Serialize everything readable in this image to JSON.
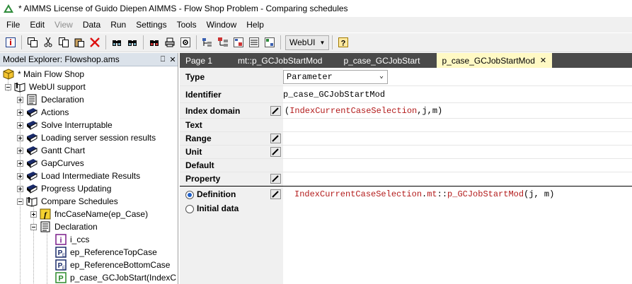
{
  "window": {
    "title": "* AIMMS License of Guido Diepen AIMMS - Flow Shop Problem - Comparing schedules"
  },
  "menu": {
    "items": [
      {
        "label": "File",
        "enabled": true
      },
      {
        "label": "Edit",
        "enabled": true
      },
      {
        "label": "View",
        "enabled": false
      },
      {
        "label": "Data",
        "enabled": true
      },
      {
        "label": "Run",
        "enabled": true
      },
      {
        "label": "Settings",
        "enabled": true
      },
      {
        "label": "Tools",
        "enabled": true
      },
      {
        "label": "Window",
        "enabled": true
      },
      {
        "label": "Help",
        "enabled": true
      }
    ]
  },
  "toolbar": {
    "webui_label": "WebUI"
  },
  "explorer": {
    "title": "Model Explorer: Flowshop.ams",
    "pin_glyph": "⎕",
    "close_glyph": "✕",
    "tree": [
      {
        "label": "* Main Flow Shop"
      },
      {
        "label": "WebUI support"
      },
      {
        "label": "Declaration"
      },
      {
        "label": "Actions"
      },
      {
        "label": "Solve Interruptable"
      },
      {
        "label": "Loading server session results"
      },
      {
        "label": "Gantt Chart"
      },
      {
        "label": "GapCurves"
      },
      {
        "label": "Load Intermediate Results"
      },
      {
        "label": "Progress Updating"
      },
      {
        "label": "Compare Schedules"
      },
      {
        "label": "fncCaseName(ep_Case)"
      },
      {
        "label": "Declaration"
      },
      {
        "label": "i_ccs"
      },
      {
        "label": "ep_ReferenceTopCase"
      },
      {
        "label": "ep_ReferenceBottomCase"
      },
      {
        "label": "p_case_GCJobStart(IndexC"
      }
    ]
  },
  "tabs": [
    {
      "label": "Page 1"
    },
    {
      "label": "mt::p_GCJobStartMod"
    },
    {
      "label": "p_case_GCJobStart"
    },
    {
      "label": "p_case_GCJobStartMod",
      "close": "✕"
    }
  ],
  "attributes": {
    "type": {
      "label": "Type",
      "value": "Parameter"
    },
    "identifier": {
      "label": "Identifier",
      "value": "p_case_GCJobStartMod"
    },
    "index_domain": {
      "label": "Index domain",
      "value_open": "(",
      "value_idx": "IndexCurrentCaseSelection",
      "value_rest": ",j,m)"
    },
    "text": {
      "label": "Text"
    },
    "range": {
      "label": "Range"
    },
    "unit": {
      "label": "Unit"
    },
    "default": {
      "label": "Default"
    },
    "property": {
      "label": "Property"
    },
    "definition": {
      "label": "Definition",
      "selected": true,
      "expr_a": "IndexCurrentCaseSelection",
      "expr_b": ".",
      "expr_c": "mt",
      "expr_d": "::",
      "expr_e": "p_GCJobStartMod",
      "expr_f": "(j, m)"
    },
    "initial_data": {
      "label": "Initial data",
      "selected": false
    }
  },
  "colors": {
    "tab_bar": "#4a4a4a",
    "tab_active": "#fff9c4",
    "explorer_header": "#dbe2ea",
    "identifier_red": "#b31b1b"
  }
}
